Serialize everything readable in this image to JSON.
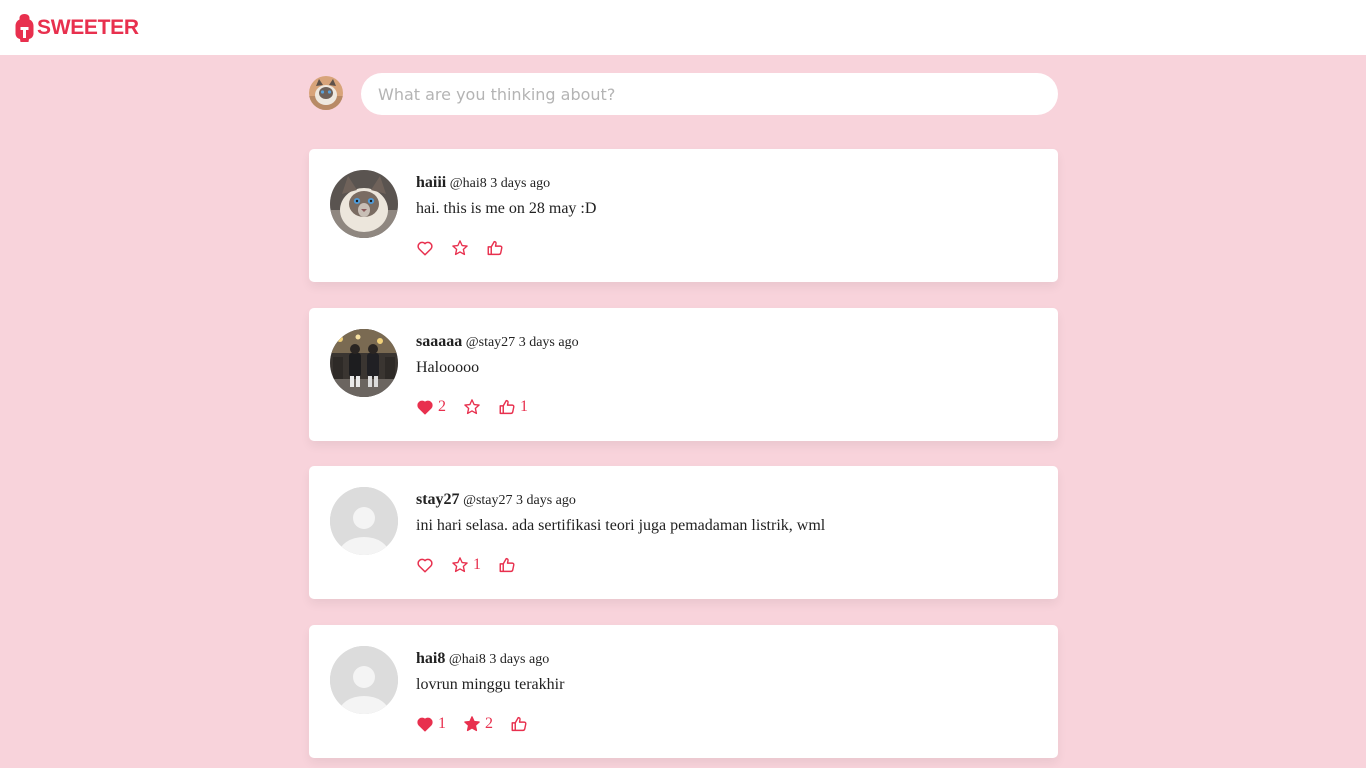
{
  "theme": {
    "accent": "#e8304e",
    "background": "#f8d3db",
    "card": "#ffffff"
  },
  "app": {
    "name": "SWEETER",
    "logo_icon": "spartan-helmet-icon"
  },
  "composer": {
    "placeholder": "What are you thinking about?",
    "value": ""
  },
  "posts": [
    {
      "name": "haiii",
      "handle": "@hai8",
      "time": "3 days ago",
      "text": "hai. this is me on 28 may :D",
      "avatar": "cat-photo",
      "likes": "",
      "liked": false,
      "stars": "",
      "starred": false,
      "thumbs": ""
    },
    {
      "name": "saaaaa",
      "handle": "@stay27",
      "time": "3 days ago",
      "text": "Halooooo",
      "avatar": "street-photo",
      "likes": "2",
      "liked": true,
      "stars": "",
      "starred": false,
      "thumbs": "1"
    },
    {
      "name": "stay27",
      "handle": "@stay27",
      "time": "3 days ago",
      "text": "ini hari selasa. ada sertifikasi teori juga pemadaman listrik, wml",
      "avatar": "default-user",
      "likes": "",
      "liked": false,
      "stars": "1",
      "starred": false,
      "thumbs": ""
    },
    {
      "name": "hai8",
      "handle": "@hai8",
      "time": "3 days ago",
      "text": "lovrun minggu terakhir",
      "avatar": "default-user",
      "likes": "1",
      "liked": true,
      "stars": "2",
      "starred": true,
      "thumbs": ""
    }
  ]
}
